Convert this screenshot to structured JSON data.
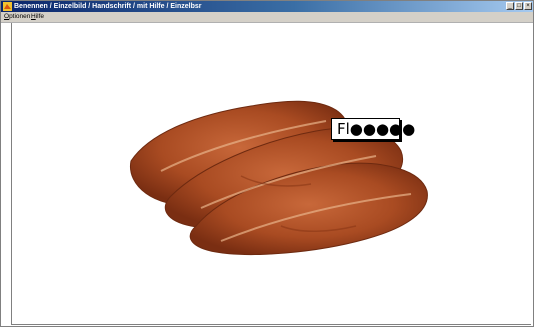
{
  "window": {
    "title": "Benennen / Einzelbild / Handschrift / mit Hilfe / Einzelbsr",
    "controls": {
      "minimize": "_",
      "maximize": "□",
      "close": "×"
    }
  },
  "menu": [
    {
      "label": "Optionen",
      "accelerator": "O",
      "rest": "ptionen"
    },
    {
      "label": "Hilfe",
      "accelerator": "H",
      "rest": "ilfe"
    }
  ],
  "image": {
    "subject": "meat-slices-image"
  },
  "answer_box": {
    "typed": "Fl",
    "hidden": "●●●●●"
  }
}
